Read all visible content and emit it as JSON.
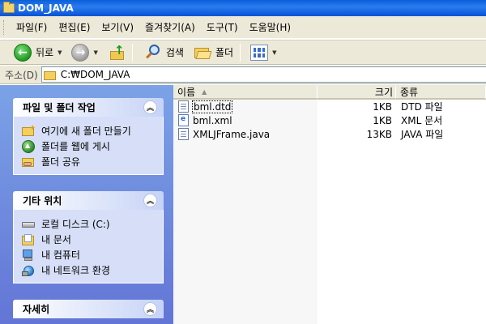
{
  "window": {
    "title": "DOM_JAVA"
  },
  "menu": {
    "items": [
      "파일(F)",
      "편집(E)",
      "보기(V)",
      "즐겨찾기(A)",
      "도구(T)",
      "도움말(H)"
    ]
  },
  "toolbar": {
    "back_label": "뒤로",
    "search_label": "검색",
    "folders_label": "폴더"
  },
  "address": {
    "label": "주소(D)",
    "value": "C:₩DOM_JAVA"
  },
  "taskpane": {
    "file_tasks": {
      "title": "파일 및 폴더 작업",
      "items": [
        "여기에 새 폴더 만들기",
        "폴더를 웹에 게시",
        "폴더 공유"
      ]
    },
    "other_places": {
      "title": "기타 위치",
      "items": [
        "로컬 디스크 (C:)",
        "내 문서",
        "내 컴퓨터",
        "내 네트워크 환경"
      ]
    },
    "details": {
      "title": "자세히"
    }
  },
  "filelist": {
    "columns": {
      "name": "이름",
      "size": "크기",
      "type": "종류"
    },
    "rows": [
      {
        "name": "bml.dtd",
        "size": "1KB",
        "type": "DTD 파일"
      },
      {
        "name": "bml.xml",
        "size": "1KB",
        "type": "XML 문서"
      },
      {
        "name": "XMLJFrame.java",
        "size": "13KB",
        "type": "JAVA 파일"
      }
    ]
  },
  "colors": {
    "titlebar": "#0a5fd8",
    "taskpane_bg": "#7ba2e7",
    "panel_body": "#d6dff7",
    "chrome": "#ece9d8"
  }
}
